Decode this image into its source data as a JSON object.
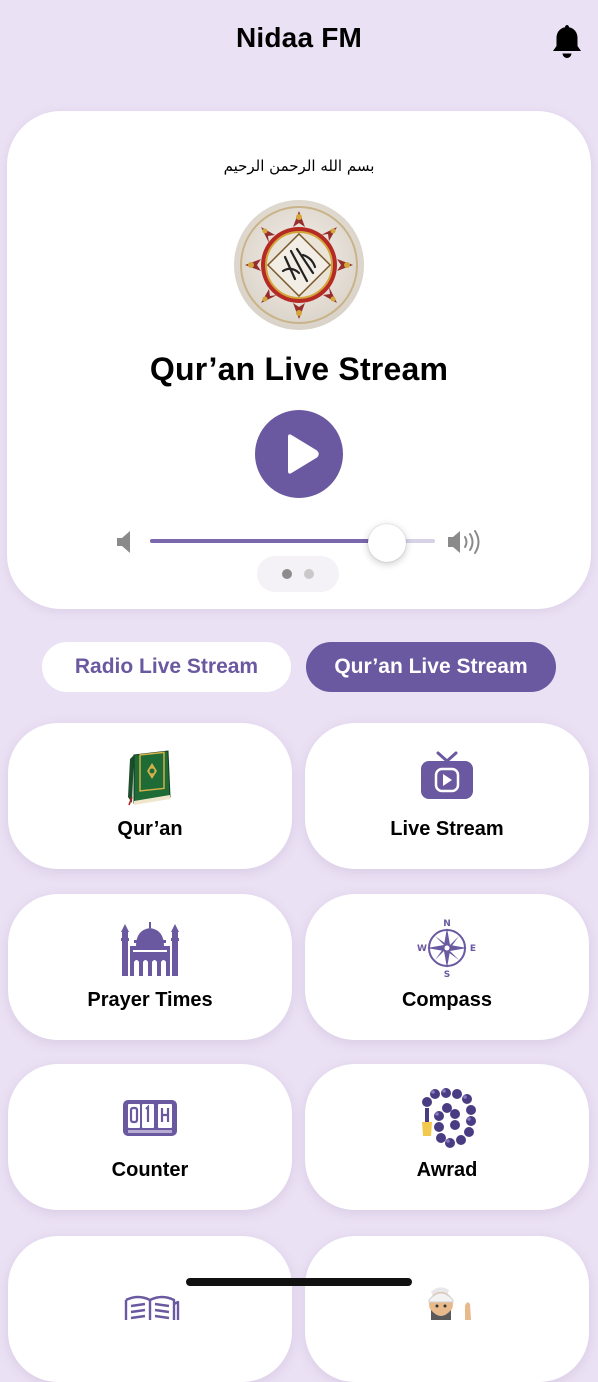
{
  "header": {
    "title": "Nidaa FM",
    "notifications_icon": "bell-icon"
  },
  "player": {
    "basmala": "بسم الله الرحمن الرحيم",
    "logo_icon": "quran-calligraphy-medallion",
    "title": "Qur’an Live Stream",
    "play_icon": "play-icon",
    "volume_level": 0.83,
    "page_indicator": {
      "count": 2,
      "active": 1
    }
  },
  "stream_switch": {
    "options": [
      "Radio Live Stream",
      "Qur’an Live Stream"
    ],
    "selected": "Qur’an Live Stream"
  },
  "features": [
    {
      "label": "Qur’an",
      "icon": "quran-book-icon"
    },
    {
      "label": "Live Stream",
      "icon": "tv-play-icon"
    },
    {
      "label": "Prayer Times",
      "icon": "mosque-icon"
    },
    {
      "label": "Compass",
      "icon": "compass-icon"
    },
    {
      "label": "Counter",
      "icon": "counter-icon"
    },
    {
      "label": "Awrad",
      "icon": "prayer-beads-icon"
    },
    {
      "label": "",
      "icon": "book-icon"
    },
    {
      "label": "",
      "icon": "praying-man-icon"
    }
  ],
  "colors": {
    "accent": "#6a58a0",
    "background": "#ebe1f4",
    "card": "#ffffff"
  }
}
